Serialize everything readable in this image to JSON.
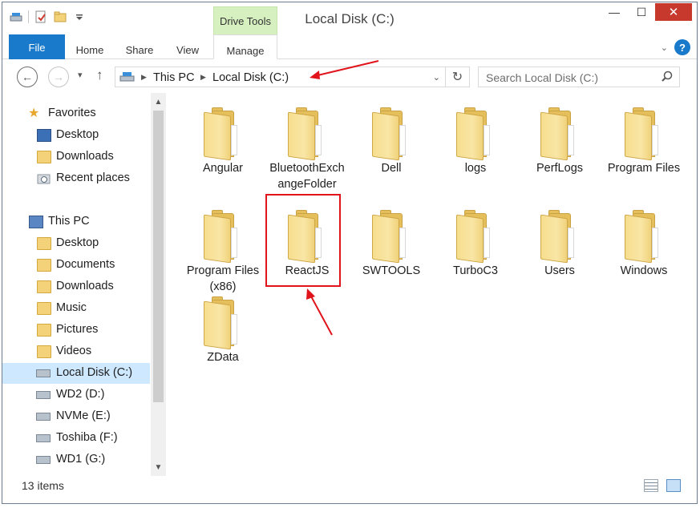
{
  "window": {
    "title": "Local Disk (C:)",
    "contextual_tab": "Drive Tools",
    "minimize_glyph": "—",
    "maximize_glyph": "☐",
    "close_glyph": "✕"
  },
  "ribbon": {
    "tabs": [
      {
        "label": "File",
        "key": "file"
      },
      {
        "label": "Home",
        "key": "home"
      },
      {
        "label": "Share",
        "key": "share"
      },
      {
        "label": "View",
        "key": "view"
      },
      {
        "label": "Manage",
        "key": "manage"
      }
    ],
    "help_glyph": "?",
    "expand_glyph": "⌄"
  },
  "navigation": {
    "back_glyph": "←",
    "forward_glyph": "→",
    "recent_glyph": "▾",
    "up_glyph": "↑",
    "breadcrumb": [
      "This PC",
      "Local Disk (C:)"
    ],
    "breadcrumb_sep": "▶",
    "address_dropdown_glyph": "⌄",
    "refresh_glyph": "↻",
    "search_placeholder": "Search Local Disk (C:)",
    "search_glyph": "⚲"
  },
  "nav_pane": {
    "items": [
      {
        "label": "Favorites",
        "icon": "star-icon",
        "level": 0
      },
      {
        "label": "Desktop",
        "icon": "desktop-icon",
        "level": 1
      },
      {
        "label": "Downloads",
        "icon": "downloads-folder-icon",
        "level": 1
      },
      {
        "label": "Recent places",
        "icon": "recent-places-icon",
        "level": 1
      },
      {
        "label": "This PC",
        "icon": "computer-icon",
        "level": 0
      },
      {
        "label": "Desktop",
        "icon": "folder-icon",
        "level": 1
      },
      {
        "label": "Documents",
        "icon": "folder-icon",
        "level": 1
      },
      {
        "label": "Downloads",
        "icon": "folder-icon",
        "level": 1
      },
      {
        "label": "Music",
        "icon": "folder-icon",
        "level": 1
      },
      {
        "label": "Pictures",
        "icon": "folder-icon",
        "level": 1
      },
      {
        "label": "Videos",
        "icon": "folder-icon",
        "level": 1
      },
      {
        "label": "Local Disk (C:)",
        "icon": "system-drive-icon",
        "level": 1,
        "selected": true
      },
      {
        "label": "WD2 (D:)",
        "icon": "drive-icon",
        "level": 1
      },
      {
        "label": "NVMe (E:)",
        "icon": "drive-icon",
        "level": 1
      },
      {
        "label": "Toshiba (F:)",
        "icon": "drive-icon",
        "level": 1
      },
      {
        "label": "WD1 (G:)",
        "icon": "drive-icon",
        "level": 1
      }
    ],
    "scroll_up_glyph": "▲",
    "scroll_down_glyph": "▼"
  },
  "folders": [
    {
      "label": "Angular"
    },
    {
      "label": "BluetoothExchangeFolder"
    },
    {
      "label": "Dell"
    },
    {
      "label": "logs"
    },
    {
      "label": "PerfLogs"
    },
    {
      "label": "Program Files"
    },
    {
      "label": "Program Files (x86)"
    },
    {
      "label": "ReactJS",
      "highlighted": true
    },
    {
      "label": "SWTOOLS"
    },
    {
      "label": "TurboC3"
    },
    {
      "label": "Users"
    },
    {
      "label": "Windows"
    },
    {
      "label": "ZData"
    }
  ],
  "status_bar": {
    "item_count": "13 items"
  },
  "colors": {
    "accent": "#1979ca",
    "selection": "#cde8ff",
    "annotation": "#e1141b",
    "close_button": "#c7382d",
    "contextual_tab": "#d6f0c0"
  }
}
